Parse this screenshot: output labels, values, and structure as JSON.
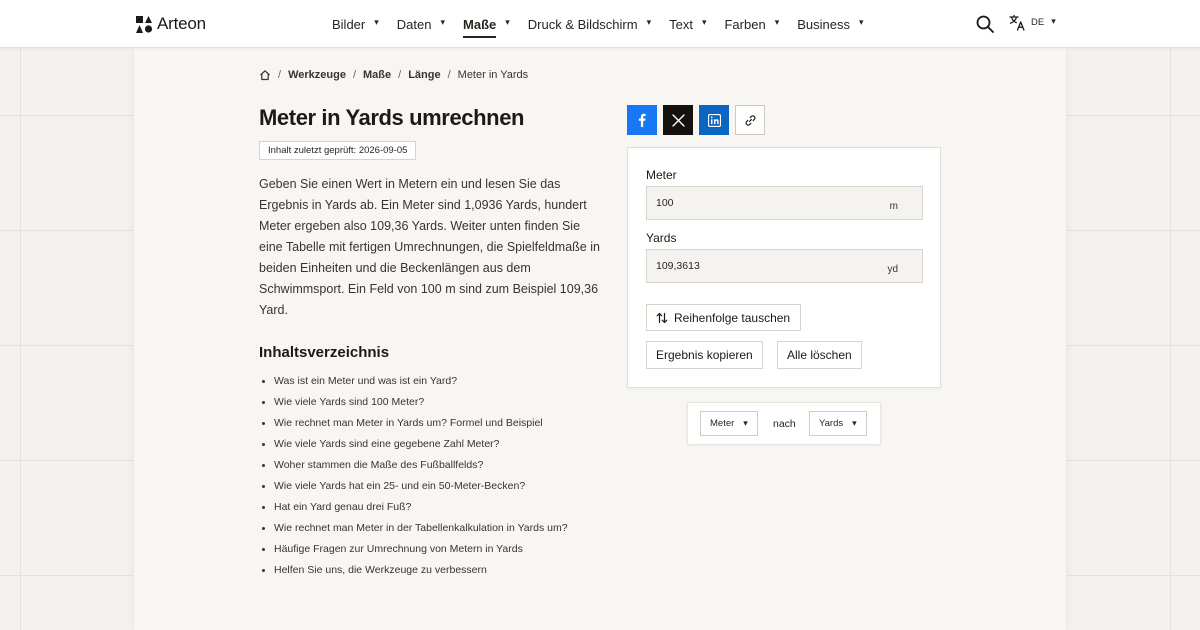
{
  "header": {
    "brand": "Arteon",
    "nav": [
      {
        "label": "Bilder",
        "active": false
      },
      {
        "label": "Daten",
        "active": false
      },
      {
        "label": "Maße",
        "active": true
      },
      {
        "label": "Druck & Bildschirm",
        "active": false
      },
      {
        "label": "Text",
        "active": false
      },
      {
        "label": "Farben",
        "active": false
      },
      {
        "label": "Business",
        "active": false
      }
    ],
    "caret": "▾",
    "language": "DE",
    "icons": {
      "search": "search-icon",
      "language": "translate-icon",
      "logo": "arteon-logo-mark"
    }
  },
  "breadcrumb": {
    "home_icon": "home-icon",
    "separator": "/",
    "items": [
      "Werkzeuge",
      "Maße",
      "Länge"
    ],
    "current": "Meter in Yards"
  },
  "page": {
    "title": "Meter in Yards umrechnen",
    "reviewed": "Inhalt zuletzt geprüft: 2026-09-05",
    "intro": "Geben Sie einen Wert in Metern ein und lesen Sie das Ergebnis in Yards ab. Ein Meter sind 1,0936 Yards, hundert Meter ergeben also 109,36 Yards. Weiter unten finden Sie eine Tabelle mit fertigen Umrechnungen, die Spielfeldmaße in beiden Einheiten und die Beckenlängen aus dem Schwimmsport. Ein Feld von 100 m sind zum Beispiel 109,36 Yard."
  },
  "toc": {
    "title": "Inhaltsverzeichnis",
    "items": [
      "Was ist ein Meter und was ist ein Yard?",
      "Wie viele Yards sind 100 Meter?",
      "Wie rechnet man Meter in Yards um? Formel und Beispiel",
      "Wie viele Yards sind eine gegebene Zahl Meter?",
      "Woher stammen die Maße des Fußballfelds?",
      "Wie viele Yards hat ein 25- und ein 50-Meter-Becken?",
      "Hat ein Yard genau drei Fuß?",
      "Wie rechnet man Meter in der Tabellenkalkulation in Yards um?",
      "Häufige Fragen zur Umrechnung von Metern in Yards",
      "Helfen Sie uns, die Werkzeuge zu verbessern"
    ]
  },
  "share": {
    "icons": [
      "facebook-icon",
      "x-icon",
      "linkedin-icon",
      "link-icon"
    ],
    "colors": {
      "facebook": "#1877f2",
      "x": "#14110f",
      "linkedin": "#0a66c2"
    }
  },
  "converter": {
    "from_label": "Meter",
    "from_value": "100",
    "from_unit": "m",
    "to_label": "Yards",
    "to_value": "109,3613",
    "to_unit": "yd",
    "swap_label": "Reihenfolge tauschen",
    "swap_icon": "swap-arrows-icon",
    "copy_label": "Ergebnis kopieren",
    "clear_label": "Alle löschen"
  },
  "unit_select": {
    "from": "Meter",
    "connector": "nach",
    "to": "Yards"
  }
}
